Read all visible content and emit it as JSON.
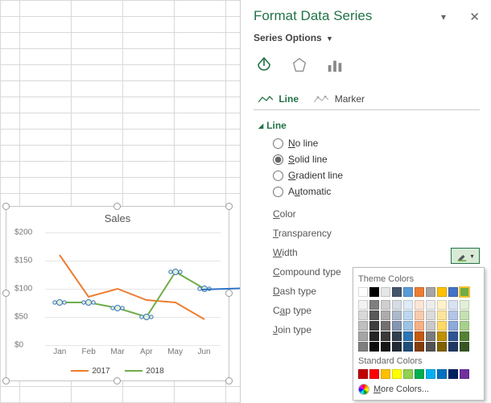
{
  "pane": {
    "title": "Format Data Series",
    "sub": "Series Options",
    "tabs": {
      "line": "Line",
      "marker": "Marker"
    },
    "section": "Line",
    "radios": {
      "none": "No line",
      "solid": "Solid line",
      "gradient": "Gradient line",
      "auto": "Automatic"
    },
    "props": {
      "color": "Color",
      "transparency": "Transparency",
      "width": "Width",
      "compound": "Compound type",
      "dash": "Dash type",
      "cap": "Cap type",
      "join": "Join type"
    }
  },
  "picker": {
    "theme": "Theme Colors",
    "standard": "Standard Colors",
    "more": "More Colors...",
    "theme_base": [
      "#ffffff",
      "#000000",
      "#e7e6e6",
      "#44546a",
      "#5b9bd5",
      "#ed7d31",
      "#a5a5a5",
      "#ffc000",
      "#4472c4",
      "#70ad47"
    ],
    "theme_tints": [
      [
        "#f2f2f2",
        "#7f7f7f",
        "#d0cece",
        "#d6dce4",
        "#deebf6",
        "#fbe5d5",
        "#ededed",
        "#fff2cc",
        "#d9e2f3",
        "#e2efd9"
      ],
      [
        "#d8d8d8",
        "#595959",
        "#aeabab",
        "#adb9ca",
        "#bdd7ee",
        "#f7cbac",
        "#dbdbdb",
        "#fee599",
        "#b4c6e7",
        "#c5e0b3"
      ],
      [
        "#bfbfbf",
        "#3f3f3f",
        "#757070",
        "#8496b0",
        "#9cc3e5",
        "#f4b183",
        "#c9c9c9",
        "#ffd965",
        "#8eaadb",
        "#a8d08d"
      ],
      [
        "#a5a5a5",
        "#262626",
        "#3a3838",
        "#323f4f",
        "#2e75b5",
        "#c55a11",
        "#7b7b7b",
        "#bf9000",
        "#2f5496",
        "#538135"
      ],
      [
        "#7f7f7f",
        "#0c0c0c",
        "#171616",
        "#222a35",
        "#1e4e79",
        "#833c0b",
        "#525252",
        "#7f6000",
        "#1f3864",
        "#375623"
      ]
    ],
    "standard_row": [
      "#c00000",
      "#ff0000",
      "#ffc000",
      "#ffff00",
      "#92d050",
      "#00b050",
      "#00b0f0",
      "#0070c0",
      "#002060",
      "#7030a0"
    ],
    "selected": "#70ad47"
  },
  "chart": {
    "title": "Sales",
    "legend": {
      "y2017": "2017",
      "y2018": "2018"
    },
    "colors": {
      "y2017": "#ed7d31",
      "y2018": "#70ad47"
    }
  },
  "chart_data": {
    "type": "line",
    "categories": [
      "Jan",
      "Feb",
      "Mar",
      "Apr",
      "May",
      "Jun"
    ],
    "series": [
      {
        "name": "2017",
        "values": [
          160,
          85,
          100,
          80,
          75,
          45
        ],
        "color": "#ed7d31"
      },
      {
        "name": "2018",
        "values": [
          75,
          75,
          65,
          50,
          130,
          100
        ],
        "color": "#70ad47"
      }
    ],
    "ylabel": "",
    "xlabel": "",
    "ylim": [
      0,
      200
    ],
    "y_ticks": [
      0,
      50,
      100,
      150,
      200
    ],
    "y_tick_labels": [
      "$0",
      "$50",
      "$100",
      "$150",
      "$200"
    ],
    "title": "Sales"
  }
}
